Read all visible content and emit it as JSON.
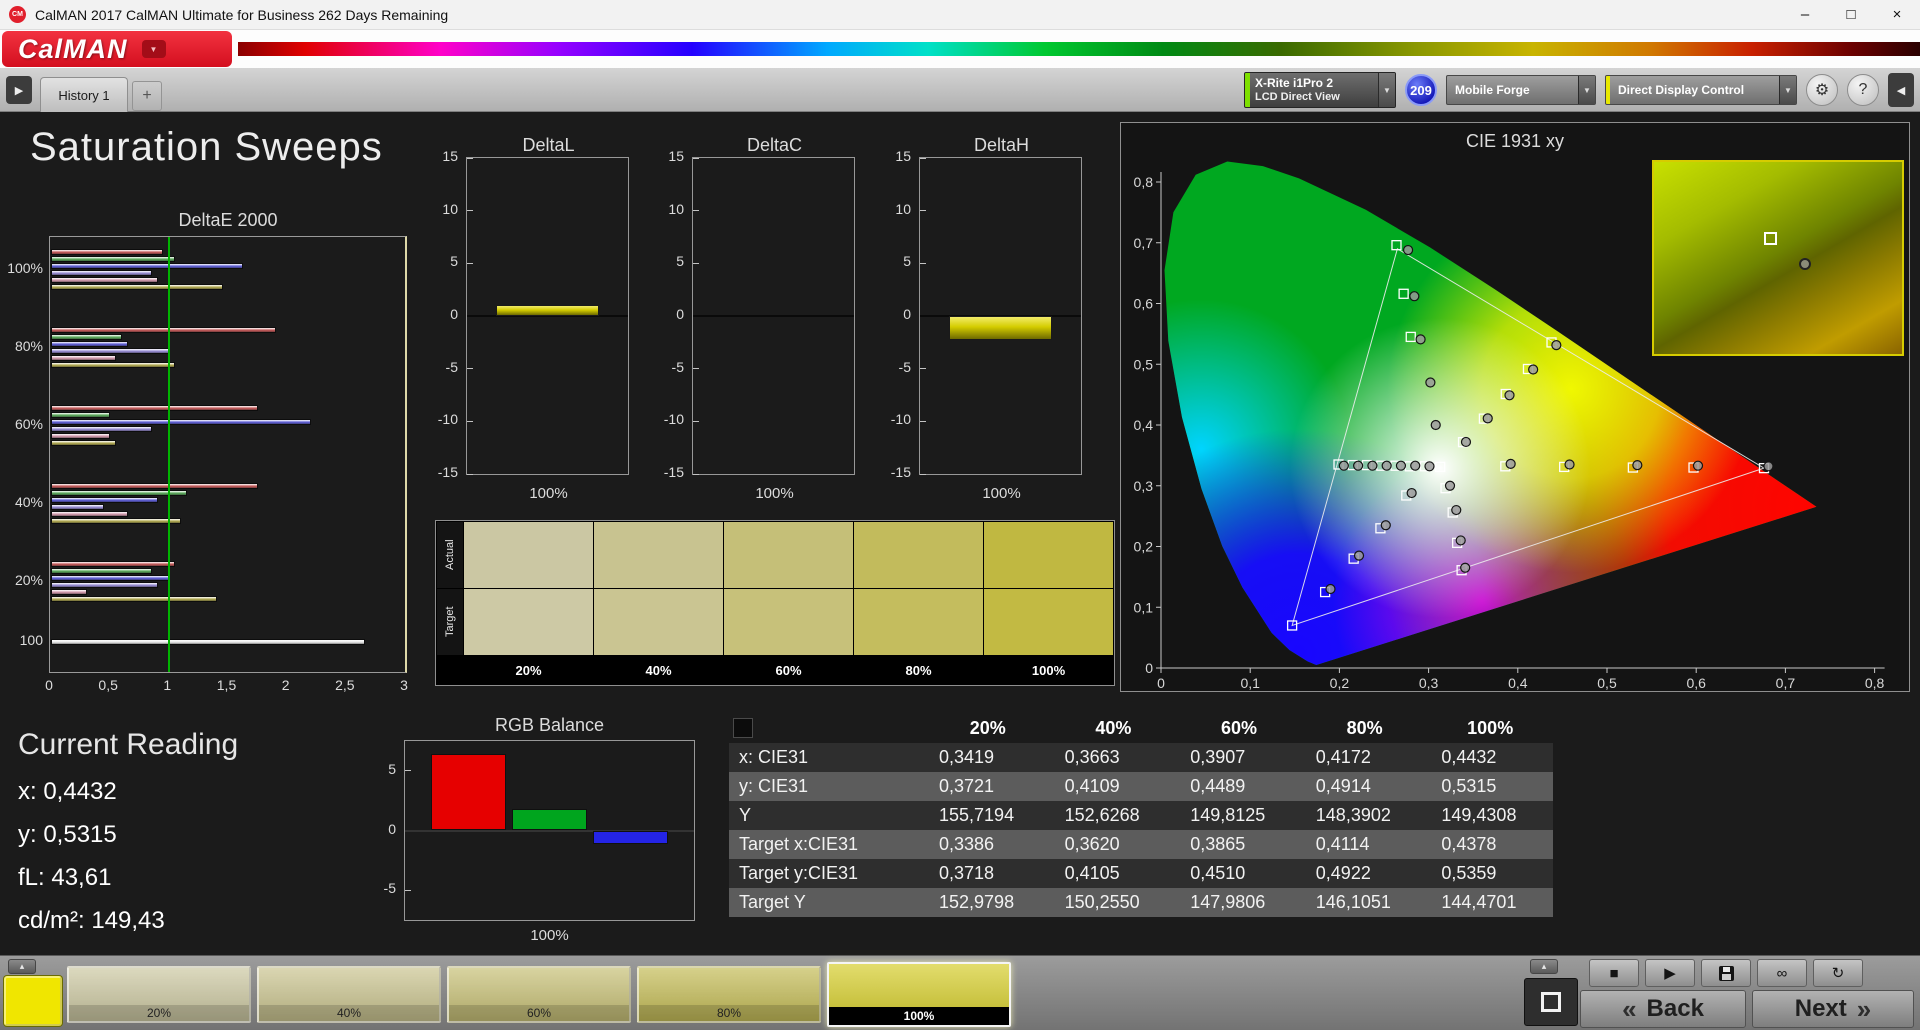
{
  "window": {
    "title": "CalMAN 2017 CalMAN Ultimate for Business 262 Days Remaining"
  },
  "brand": {
    "logo_text": "CalMAN"
  },
  "tabbar": {
    "history_tab": "History 1",
    "add_tab": "+",
    "meter": {
      "line1": "X-Rite i1Pro 2",
      "line2": "LCD Direct View",
      "accent": "#7ee000"
    },
    "badge": "209",
    "source": {
      "label": "Mobile Forge"
    },
    "display_control": {
      "label": "Direct Display Control",
      "accent": "#e8e800"
    }
  },
  "page": {
    "title": "Saturation Sweeps"
  },
  "current_reading": {
    "title": "Current Reading",
    "lines": [
      "x: 0,4432",
      "y: 0,5315",
      "fL: 43,61",
      "cd/m²: 149,43"
    ]
  },
  "swatches": {
    "row_labels": [
      "Actual",
      "Target"
    ],
    "columns": [
      "20%",
      "40%",
      "60%",
      "80%",
      "100%"
    ],
    "actual_colors": [
      "#cbc7a3",
      "#c8c390",
      "#c5bf78",
      "#c2bb5c",
      "#c0b841"
    ],
    "target_colors": [
      "#cdc9a5",
      "#cac592",
      "#c7c17a",
      "#c4bd5e",
      "#c2ba43"
    ]
  },
  "bottombar": {
    "patch_color": "#f0e600",
    "swatch_buttons": [
      {
        "label": "20%",
        "color": "#ccc8a2",
        "selected": false
      },
      {
        "label": "40%",
        "color": "#cac490",
        "selected": false
      },
      {
        "label": "60%",
        "color": "#c7c077",
        "selected": false
      },
      {
        "label": "80%",
        "color": "#c4bc58",
        "selected": false
      },
      {
        "label": "100%",
        "color": "#d6ce2e",
        "selected": true
      }
    ],
    "back_label": "Back",
    "next_label": "Next"
  },
  "icons": {
    "app": "CM",
    "minimize": "–",
    "maximize": "□",
    "close": "×",
    "dropdown": "▼",
    "panel_expand": "▶",
    "panel_collapse": "◀",
    "gear": "⚙",
    "help": "?",
    "expand_up": "▴",
    "stop": "■",
    "play": "▶",
    "infinity": "∞",
    "refresh": "↻",
    "back_chevrons": "«",
    "next_chevrons": "»"
  },
  "chart_data": [
    {
      "name": "deltae2000",
      "type": "bar",
      "title": "DeltaE 2000",
      "orientation": "horizontal",
      "xlim": [
        0,
        3
      ],
      "x_ticks": [
        "0",
        "0,5",
        "1",
        "1,5",
        "2",
        "2,5",
        "3"
      ],
      "reference_line": {
        "value": 1,
        "color": "#00b400"
      },
      "bar_colors": [
        "#c65b5b",
        "#5dab5d",
        "#6060d8",
        "#9a8fd6",
        "#d49cae",
        "#b3ab52"
      ],
      "white_bar_color": "#e8e8e8",
      "groups": [
        {
          "label": "100%",
          "values": [
            0.95,
            1.05,
            1.62,
            0.85,
            0.9,
            1.45
          ]
        },
        {
          "label": "80%",
          "values": [
            1.9,
            0.6,
            0.65,
            1.0,
            0.55,
            1.05
          ]
        },
        {
          "label": "60%",
          "values": [
            1.75,
            0.5,
            2.2,
            0.85,
            0.5,
            0.55
          ]
        },
        {
          "label": "40%",
          "values": [
            1.75,
            1.15,
            0.9,
            0.45,
            0.65,
            1.1
          ]
        },
        {
          "label": "20%",
          "values": [
            1.05,
            0.85,
            1.0,
            0.9,
            0.3,
            1.4
          ]
        },
        {
          "label": "100",
          "values": [
            2.65
          ]
        }
      ]
    },
    {
      "name": "deltaL",
      "type": "bar",
      "title": "DeltaL",
      "xlabel": "100%",
      "ylim": [
        -15,
        15
      ],
      "y_ticks": [
        "15",
        "10",
        "5",
        "0",
        "-5",
        "-10",
        "-15"
      ],
      "values": [
        1.0
      ],
      "color": "#d4cc00"
    },
    {
      "name": "deltaC",
      "type": "bar",
      "title": "DeltaC",
      "xlabel": "100%",
      "ylim": [
        -15,
        15
      ],
      "y_ticks": [
        "15",
        "10",
        "5",
        "0",
        "-5",
        "-10",
        "-15"
      ],
      "values": [
        0.0
      ],
      "color": "#d4cc00"
    },
    {
      "name": "deltaH",
      "type": "bar",
      "title": "DeltaH",
      "xlabel": "100%",
      "ylim": [
        -15,
        15
      ],
      "y_ticks": [
        "15",
        "10",
        "5",
        "0",
        "-5",
        "-10",
        "-15"
      ],
      "values": [
        -2.3
      ],
      "color": "#d4cc00"
    },
    {
      "name": "rgb_balance",
      "type": "bar",
      "title": "RGB Balance",
      "xlabel": "100%",
      "ylim": [
        -7.5,
        7.5
      ],
      "y_ticks": [
        "5",
        "0",
        "-5"
      ],
      "series": [
        {
          "name": "Red",
          "value": 6.4,
          "color": "#e60000"
        },
        {
          "name": "Green",
          "value": 1.8,
          "color": "#00a51e"
        },
        {
          "name": "Blue",
          "value": -1.1,
          "color": "#2424e6"
        }
      ]
    },
    {
      "name": "cie1931",
      "type": "scatter",
      "title": "CIE 1931 xy",
      "xlim": [
        0,
        0.8
      ],
      "ylim": [
        0,
        0.8
      ],
      "ticks": [
        "0",
        "0,1",
        "0,2",
        "0,3",
        "0,4",
        "0,5",
        "0,6",
        "0,7",
        "0,8"
      ],
      "gamut_triangle": [
        [
          0.265,
          0.69
        ],
        [
          0.676,
          0.329
        ],
        [
          0.147,
          0.07
        ]
      ],
      "targets": [
        [
          0.264,
          0.696
        ],
        [
          0.272,
          0.616
        ],
        [
          0.28,
          0.545
        ],
        [
          0.199,
          0.335
        ],
        [
          0.215,
          0.334
        ],
        [
          0.231,
          0.334
        ],
        [
          0.247,
          0.333
        ],
        [
          0.263,
          0.333
        ],
        [
          0.279,
          0.332
        ],
        [
          0.296,
          0.332
        ],
        [
          0.313,
          0.331
        ],
        [
          0.386,
          0.332
        ],
        [
          0.452,
          0.331
        ],
        [
          0.529,
          0.33
        ],
        [
          0.597,
          0.33
        ],
        [
          0.676,
          0.329
        ],
        [
          0.275,
          0.284
        ],
        [
          0.246,
          0.23
        ],
        [
          0.216,
          0.18
        ],
        [
          0.184,
          0.125
        ],
        [
          0.147,
          0.07
        ],
        [
          0.319,
          0.296
        ],
        [
          0.327,
          0.256
        ],
        [
          0.332,
          0.206
        ],
        [
          0.337,
          0.161
        ],
        [
          0.3386,
          0.3718
        ],
        [
          0.362,
          0.4105
        ],
        [
          0.3865,
          0.451
        ],
        [
          0.4114,
          0.4922
        ],
        [
          0.4378,
          0.5359
        ]
      ],
      "measured": [
        [
          0.277,
          0.688
        ],
        [
          0.284,
          0.612
        ],
        [
          0.291,
          0.541
        ],
        [
          0.302,
          0.47
        ],
        [
          0.308,
          0.4
        ],
        [
          0.3419,
          0.3721
        ],
        [
          0.3663,
          0.4109
        ],
        [
          0.3907,
          0.4489
        ],
        [
          0.4172,
          0.4914
        ],
        [
          0.4432,
          0.5315
        ],
        [
          0.392,
          0.336
        ],
        [
          0.458,
          0.335
        ],
        [
          0.534,
          0.334
        ],
        [
          0.602,
          0.333
        ],
        [
          0.681,
          0.332
        ],
        [
          0.281,
          0.288
        ],
        [
          0.252,
          0.235
        ],
        [
          0.222,
          0.185
        ],
        [
          0.19,
          0.13
        ],
        [
          0.324,
          0.3
        ],
        [
          0.331,
          0.26
        ],
        [
          0.336,
          0.21
        ],
        [
          0.341,
          0.165
        ],
        [
          0.205,
          0.333
        ],
        [
          0.221,
          0.333
        ],
        [
          0.237,
          0.333
        ],
        [
          0.253,
          0.333
        ],
        [
          0.269,
          0.333
        ],
        [
          0.285,
          0.333
        ],
        [
          0.301,
          0.332
        ]
      ],
      "inset": {
        "square": [
          0.47,
          0.4
        ],
        "circle": [
          0.61,
          0.53
        ]
      }
    },
    {
      "name": "saturation_table",
      "type": "table",
      "columns": [
        "20%",
        "40%",
        "60%",
        "80%",
        "100%"
      ],
      "rows": [
        {
          "label": "x: CIE31",
          "values": [
            "0,3419",
            "0,3663",
            "0,3907",
            "0,4172",
            "0,4432"
          ]
        },
        {
          "label": "y: CIE31",
          "values": [
            "0,3721",
            "0,4109",
            "0,4489",
            "0,4914",
            "0,5315"
          ]
        },
        {
          "label": "Y",
          "values": [
            "155,7194",
            "152,6268",
            "149,8125",
            "148,3902",
            "149,4308"
          ]
        },
        {
          "label": "Target x:CIE31",
          "values": [
            "0,3386",
            "0,3620",
            "0,3865",
            "0,4114",
            "0,4378"
          ]
        },
        {
          "label": "Target y:CIE31",
          "values": [
            "0,3718",
            "0,4105",
            "0,4510",
            "0,4922",
            "0,5359"
          ]
        },
        {
          "label": "Target Y",
          "values": [
            "152,9798",
            "150,2550",
            "147,9806",
            "146,1051",
            "144,4701"
          ]
        }
      ]
    }
  ]
}
